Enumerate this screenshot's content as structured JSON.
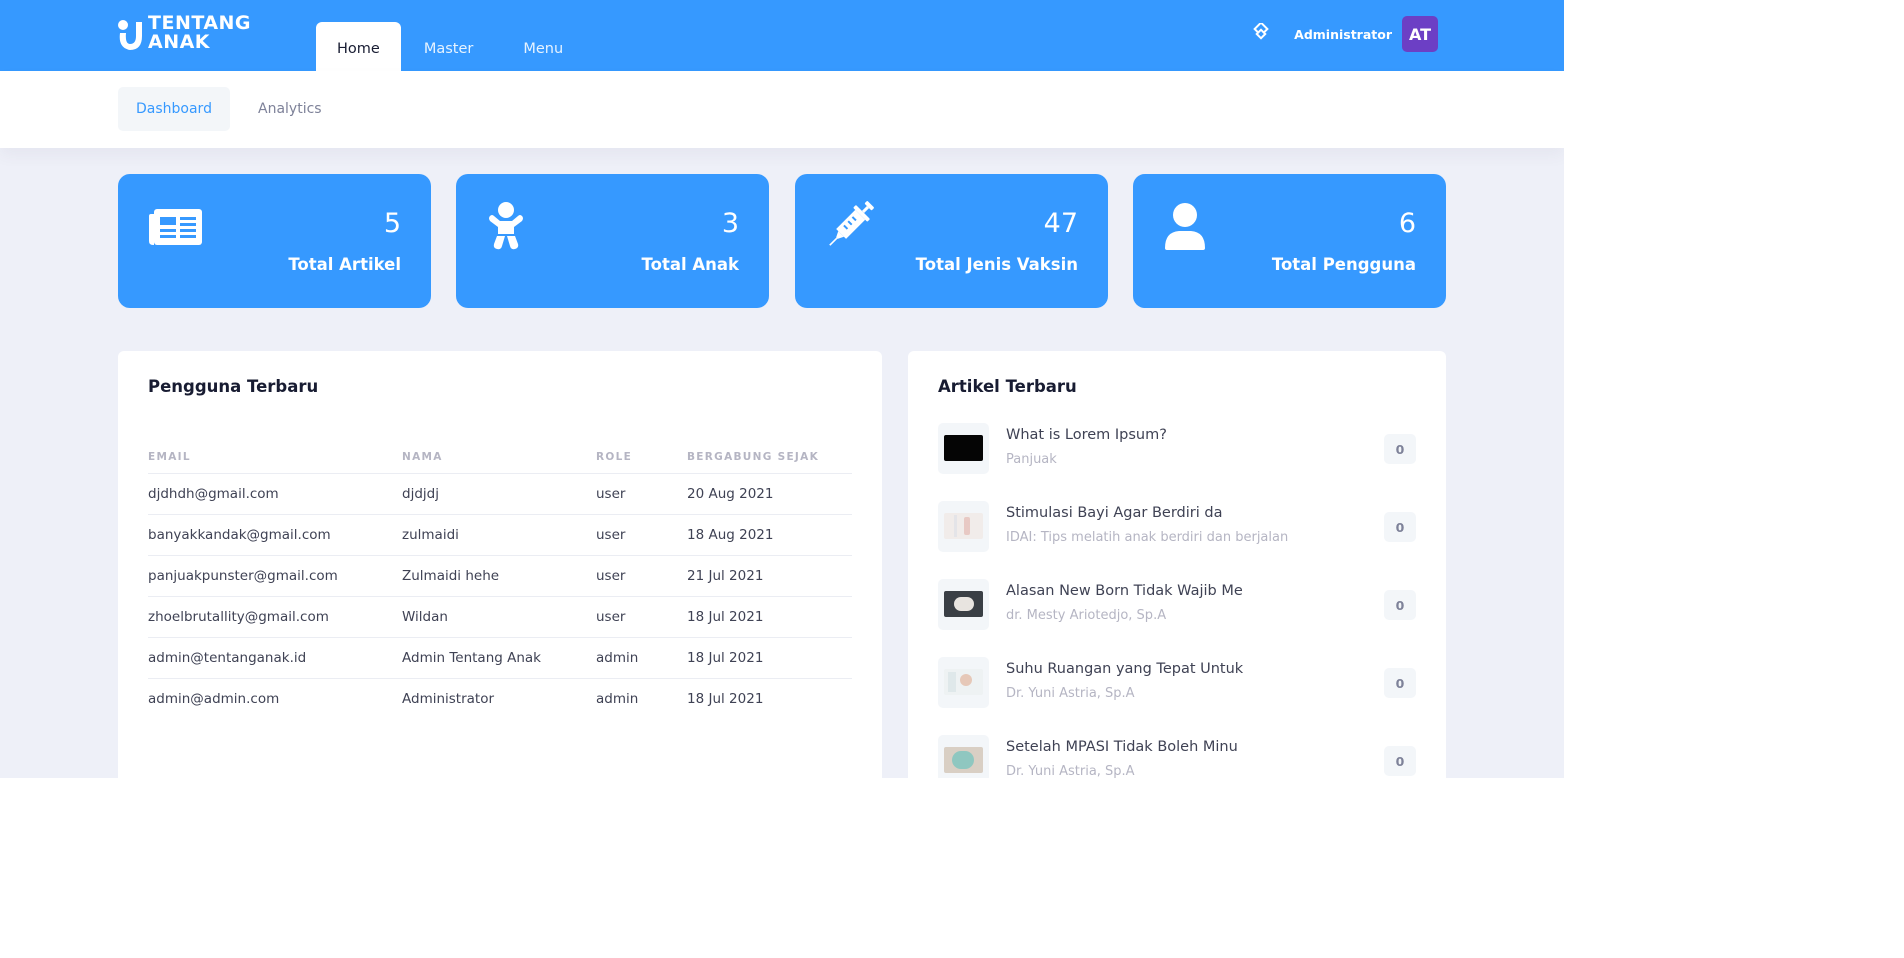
{
  "brand": {
    "line1": "TENTANG",
    "line2": "ANAK"
  },
  "nav": {
    "tabs": [
      {
        "label": "Home"
      },
      {
        "label": "Master"
      },
      {
        "label": "Menu"
      }
    ]
  },
  "user": {
    "name": "Administrator",
    "initials": "AT",
    "avatar_color": "#6c3fc5"
  },
  "subnav": {
    "tabs": [
      {
        "label": "Dashboard"
      },
      {
        "label": "Analytics"
      }
    ]
  },
  "colors": {
    "primary": "#3699ff",
    "page_bg": "#eef0f8",
    "muted": "#b5b5c3"
  },
  "stats": [
    {
      "icon": "newspaper-icon",
      "value": "5",
      "label": "Total Artikel"
    },
    {
      "icon": "baby-icon",
      "value": "3",
      "label": "Total Anak"
    },
    {
      "icon": "syringe-icon",
      "value": "47",
      "label": "Total Jenis Vaksin"
    },
    {
      "icon": "user-icon",
      "value": "6",
      "label": "Total Pengguna"
    }
  ],
  "recent_users": {
    "title": "Pengguna Terbaru",
    "columns": [
      "EMAIL",
      "NAMA",
      "ROLE",
      "BERGABUNG SEJAK"
    ],
    "rows": [
      [
        "djdhdh@gmail.com",
        "djdjdj",
        "user",
        "20 Aug 2021"
      ],
      [
        "banyakkandak@gmail.com",
        "zulmaidi",
        "user",
        "18 Aug 2021"
      ],
      [
        "panjuakpunster@gmail.com",
        "Zulmaidi hehe",
        "user",
        "21 Jul 2021"
      ],
      [
        "zhoelbrutallity@gmail.com",
        "Wildan",
        "user",
        "18 Jul 2021"
      ],
      [
        "admin@tentanganak.id",
        "Admin Tentang Anak",
        "admin",
        "18 Jul 2021"
      ],
      [
        "admin@admin.com",
        "Administrator",
        "admin",
        "18 Jul 2021"
      ]
    ]
  },
  "recent_articles": {
    "title": "Artikel Terbaru",
    "items": [
      {
        "title": "What is Lorem Ipsum?",
        "subtitle": "Panjuak",
        "count": "0"
      },
      {
        "title": "Stimulasi Bayi Agar Berdiri da",
        "subtitle": "IDAI: Tips melatih anak berdiri dan berjalan",
        "count": "0"
      },
      {
        "title": "Alasan New Born Tidak Wajib Me",
        "subtitle": "dr. Mesty Ariotedjo, Sp.A",
        "count": "0"
      },
      {
        "title": "Suhu Ruangan yang Tepat Untuk",
        "subtitle": "Dr. Yuni Astria, Sp.A",
        "count": "0"
      },
      {
        "title": "Setelah MPASI Tidak Boleh Minu",
        "subtitle": "Dr. Yuni Astria, Sp.A",
        "count": "0"
      }
    ]
  }
}
